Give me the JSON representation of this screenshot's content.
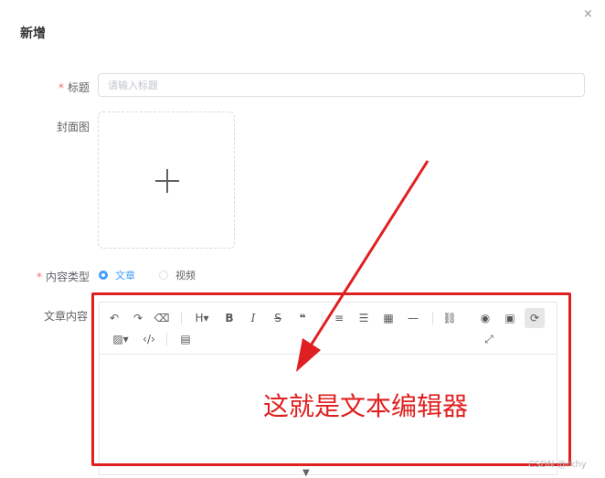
{
  "dialog": {
    "title": "新增",
    "close_glyph": "×"
  },
  "form": {
    "title_required": "*",
    "title_label": "标题",
    "title_placeholder": "请输入标题",
    "title_value": "",
    "cover_label": "封面图",
    "type_required": "*",
    "type_label": "内容类型",
    "type_options": [
      {
        "label": "文章",
        "selected": true
      },
      {
        "label": "视频",
        "selected": false
      }
    ],
    "content_label": "文章内容"
  },
  "editor": {
    "toolbar_glyphs": {
      "undo": "↶",
      "redo": "↷",
      "eraser": "⌫",
      "heading": "H▾",
      "bold": "B",
      "italic": "I",
      "strike": "S",
      "quote": "❝",
      "ul": "≡",
      "ol": "☰",
      "table": "▦",
      "hr": "—",
      "link": "⛓",
      "preview": "◉",
      "panel": "▣",
      "sync": "⟳",
      "image": "▨▾",
      "code": "‹/›",
      "save": "▤",
      "fullscreen": "⤢"
    }
  },
  "annotation": {
    "text": "这就是文本编辑器",
    "color": "#e02020"
  },
  "watermark": "CSDN @rkhy",
  "colors": {
    "primary": "#409eff",
    "required": "#f56c6c"
  }
}
